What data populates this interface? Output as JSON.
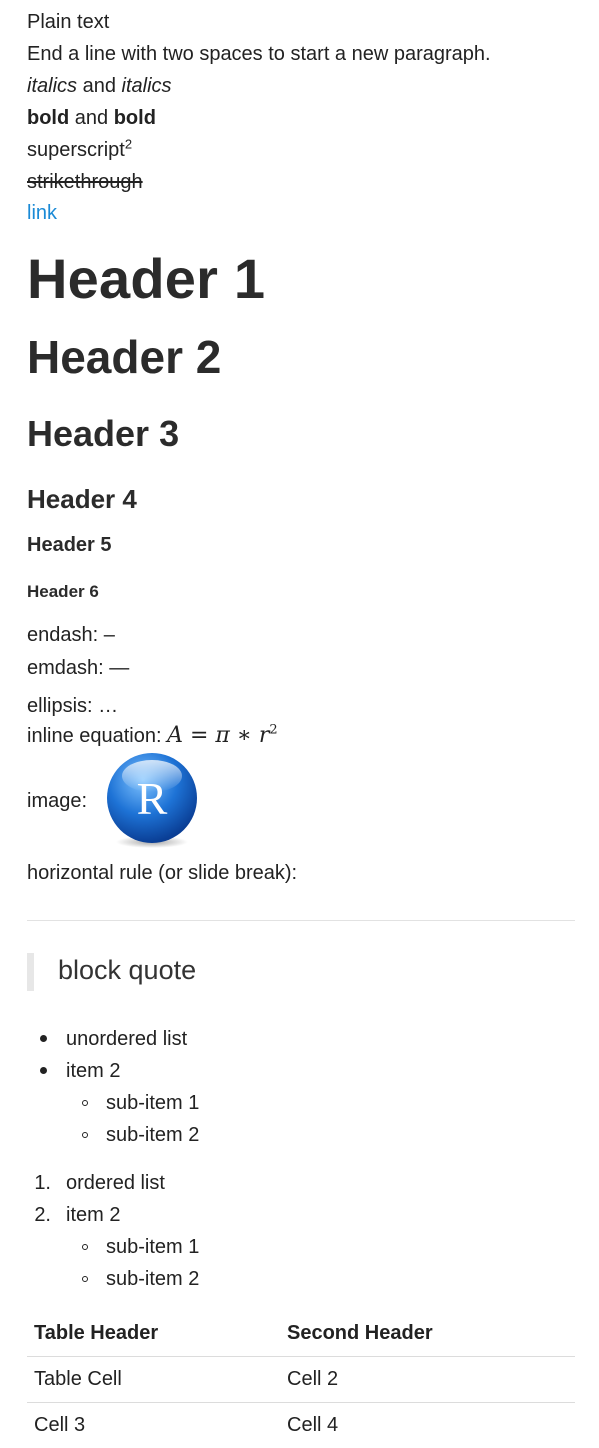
{
  "text": {
    "plain": "Plain text",
    "paragraph_note": "End a line with two spaces to start a new paragraph.",
    "italics_a": "italics",
    "and_1": " and ",
    "italics_b": "italics",
    "bold_a": "bold",
    "and_2": " and ",
    "bold_b": "bold",
    "superscript_base": "superscript",
    "superscript_exp": "2",
    "strikethrough": "strikethrough",
    "link": "link"
  },
  "headers": {
    "h1": "Header 1",
    "h2": "Header 2",
    "h3": "Header 3",
    "h4": "Header 4",
    "h5": "Header 5",
    "h6": "Header 6"
  },
  "punctuation": {
    "endash": "endash: –",
    "emdash": "emdash: —",
    "ellipsis": "ellipsis: …"
  },
  "equation": {
    "label": "inline equation: ",
    "lhs": "A",
    "eq": " = ",
    "pi": "π",
    "times": " ∗ ",
    "r": "r",
    "exp": "2"
  },
  "image": {
    "label": "image:",
    "logo_letter": "R",
    "icon": "r-logo-icon",
    "colors": {
      "sphere_light": "#7fc3ff",
      "sphere_mid": "#1e73d6",
      "sphere_dark": "#0a3e95",
      "letter": "#ffffff",
      "shadow": "#8a8a8a"
    }
  },
  "rule": {
    "label": "horizontal rule (or slide break):"
  },
  "blockquote": {
    "text": "block quote"
  },
  "unordered_list": {
    "items": [
      "unordered list",
      "item 2"
    ],
    "sub_items": [
      "sub-item 1",
      "sub-item 2"
    ]
  },
  "ordered_list": {
    "markers": [
      "1.",
      "2."
    ],
    "items": [
      "ordered list",
      "item 2"
    ],
    "sub_items": [
      "sub-item 1",
      "sub-item 2"
    ]
  },
  "table": {
    "headers": [
      "Table Header",
      "Second Header"
    ],
    "rows": [
      [
        "Table Cell",
        "Cell 2"
      ],
      [
        "Cell 3",
        "Cell 4"
      ]
    ]
  },
  "colors": {
    "text": "#222222",
    "link": "#1a8ad6",
    "rule": "#e2e2e2",
    "blockquote_bar": "#e7e7e7"
  }
}
